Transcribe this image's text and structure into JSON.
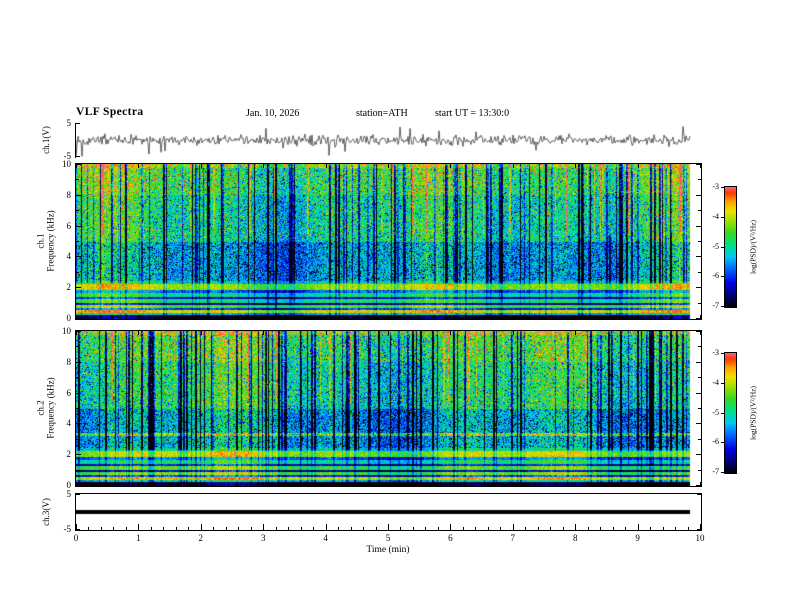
{
  "header": {
    "title": "VLF Spectra",
    "date": "Jan. 10, 2026",
    "station": "station=ATH",
    "start_ut": "start UT =  13:30:0"
  },
  "xaxis": {
    "label": "Time (min)",
    "ticks": [
      0,
      1,
      2,
      3,
      4,
      5,
      6,
      7,
      8,
      9,
      10
    ],
    "minors_per_major": 5
  },
  "panels": {
    "wave1": {
      "ylabel": "ch.1(V)",
      "yticks": [
        5,
        -5
      ]
    },
    "spec1": {
      "ylabel_lines": [
        "ch.1",
        "Frequency (kHz)"
      ],
      "yticks": [
        0,
        2,
        4,
        6,
        8,
        10
      ]
    },
    "spec2": {
      "ylabel_lines": [
        "ch.2",
        "Frequency (kHz)"
      ],
      "yticks": [
        0,
        2,
        4,
        6,
        8,
        10
      ]
    },
    "wave3": {
      "ylabel": "ch.3(V)",
      "yticks": [
        5,
        -5
      ]
    }
  },
  "colorbar": {
    "label": "log(PSD)/(V²/Hz)",
    "ticks": [
      -3,
      -4,
      -5,
      -6,
      -7
    ],
    "stops": [
      {
        "t": 0.0,
        "c": "#000000"
      },
      {
        "t": 0.09,
        "c": "#000070"
      },
      {
        "t": 0.2,
        "c": "#0000e8"
      },
      {
        "t": 0.32,
        "c": "#0068ff"
      },
      {
        "t": 0.42,
        "c": "#00c8f0"
      },
      {
        "t": 0.52,
        "c": "#00e080"
      },
      {
        "t": 0.62,
        "c": "#38d820"
      },
      {
        "t": 0.72,
        "c": "#a0e000"
      },
      {
        "t": 0.8,
        "c": "#f0e000"
      },
      {
        "t": 0.88,
        "c": "#ffa000"
      },
      {
        "t": 0.95,
        "c": "#ff3800"
      },
      {
        "t": 1.0,
        "c": "#ff6080"
      }
    ]
  },
  "chart_data": [
    {
      "type": "line",
      "name": "ch.1(V) waveform",
      "xlabel": "Time (min)",
      "ylabel": "ch.1(V)",
      "xlim": [
        0,
        10
      ],
      "ylim": [
        -5,
        5
      ],
      "time_span_min": [
        0,
        9.84
      ],
      "signal": "zero-mean broadband noise of roughly ±1.5 V with frequent impulsive spikes reaching ±5 V throughout the full record"
    },
    {
      "type": "heatmap",
      "name": "ch.1 spectrogram",
      "xlabel": "Time (min)",
      "ylabel": "ch.1 Frequency (kHz)",
      "zlabel": "log(PSD)/(V²/Hz)",
      "xlim": [
        0,
        10
      ],
      "ylim": [
        0,
        10
      ],
      "zlim": [
        -7,
        -3
      ],
      "bands": [
        {
          "f": [
            9.75,
            10.01
          ],
          "psd": -4.0
        },
        {
          "f": [
            8.0,
            9.75
          ],
          "psd": -4.55
        },
        {
          "f": [
            5.0,
            8.0
          ],
          "psd": -4.85
        },
        {
          "f": [
            2.45,
            5.0
          ],
          "psd": -5.25
        },
        {
          "f": [
            2.25,
            2.45
          ],
          "psd": -5.0
        },
        {
          "f": [
            1.85,
            2.25
          ],
          "psd": -4.0
        },
        {
          "f": [
            1.7,
            1.85
          ],
          "psd": -5.6
        },
        {
          "f": [
            1.45,
            1.7
          ],
          "psd": -4.8
        },
        {
          "f": [
            1.3,
            1.45
          ],
          "psd": -6.1
        },
        {
          "f": [
            1.05,
            1.3
          ],
          "psd": -4.7
        },
        {
          "f": [
            0.9,
            1.05
          ],
          "psd": -6.3
        },
        {
          "f": [
            0.72,
            0.9
          ],
          "psd": -4.3
        },
        {
          "f": [
            0.55,
            0.72
          ],
          "psd": -5.8
        },
        {
          "f": [
            0.38,
            0.55
          ],
          "psd": -3.7
        },
        {
          "f": [
            0.28,
            0.38
          ],
          "psd": -5.2
        },
        {
          "f": [
            0.0,
            0.28
          ],
          "psd": -6.9
        }
      ],
      "striations": {
        "impulse_probability": 0.17,
        "impulse_depth_db": [
          0.8,
          3.0
        ],
        "hot_probability": 0.06,
        "hot_boost_db": [
          0.7,
          1.8
        ]
      },
      "description": "green broadband background with dense dark-blue vertical impulsive striations above ~2.5 kHz, red/orange streaks near 6-10 kHz, bright band near 2 kHz, alternating bright/dark horizontal lines below 1.5 kHz, red line near 0.5 kHz and black band below 0.3 kHz"
    },
    {
      "type": "heatmap",
      "name": "ch.2 spectrogram",
      "xlabel": "Time (min)",
      "ylabel": "ch.2 Frequency (kHz)",
      "zlabel": "log(PSD)/(V²/Hz)",
      "xlim": [
        0,
        10
      ],
      "ylim": [
        0,
        10
      ],
      "zlim": [
        -7,
        -3
      ],
      "bands": [
        {
          "f": [
            9.75,
            10.01
          ],
          "psd": -4.0
        },
        {
          "f": [
            8.0,
            9.75
          ],
          "psd": -4.6
        },
        {
          "f": [
            5.0,
            8.0
          ],
          "psd": -4.85
        },
        {
          "f": [
            3.45,
            5.0
          ],
          "psd": -5.25
        },
        {
          "f": [
            3.22,
            3.45
          ],
          "psd": -4.05
        },
        {
          "f": [
            2.45,
            3.22
          ],
          "psd": -5.25
        },
        {
          "f": [
            2.25,
            2.45
          ],
          "psd": -5.0
        },
        {
          "f": [
            1.85,
            2.25
          ],
          "psd": -4.0
        },
        {
          "f": [
            1.7,
            1.85
          ],
          "psd": -5.6
        },
        {
          "f": [
            1.45,
            1.7
          ],
          "psd": -4.8
        },
        {
          "f": [
            1.3,
            1.45
          ],
          "psd": -6.1
        },
        {
          "f": [
            1.05,
            1.3
          ],
          "psd": -4.4
        },
        {
          "f": [
            0.9,
            1.05
          ],
          "psd": -6.3
        },
        {
          "f": [
            0.72,
            0.9
          ],
          "psd": -4.3
        },
        {
          "f": [
            0.55,
            0.72
          ],
          "psd": -5.8
        },
        {
          "f": [
            0.38,
            0.55
          ],
          "psd": -3.7
        },
        {
          "f": [
            0.28,
            0.38
          ],
          "psd": -5.2
        },
        {
          "f": [
            0.0,
            0.28
          ],
          "psd": -6.9
        }
      ],
      "striations": {
        "impulse_probability": 0.19,
        "impulse_depth_db": [
          1.0,
          3.2
        ],
        "hot_probability": 0.035,
        "hot_boost_db": [
          0.6,
          1.5
        ]
      },
      "description": "similar to ch.1 but with stronger/denser dark-blue vertical striations, an extra orange horizontal band near 3.3 kHz and fewer red streaks at the top"
    },
    {
      "type": "line",
      "name": "ch.3(V) waveform",
      "xlabel": "Time (min)",
      "ylabel": "ch.3(V)",
      "xlim": [
        0,
        10
      ],
      "ylim": [
        -5,
        5
      ],
      "time_span_min": [
        0,
        9.84
      ],
      "signal": "constant flat thick black trace at approximately 0 V (no signal on channel 3)"
    }
  ]
}
